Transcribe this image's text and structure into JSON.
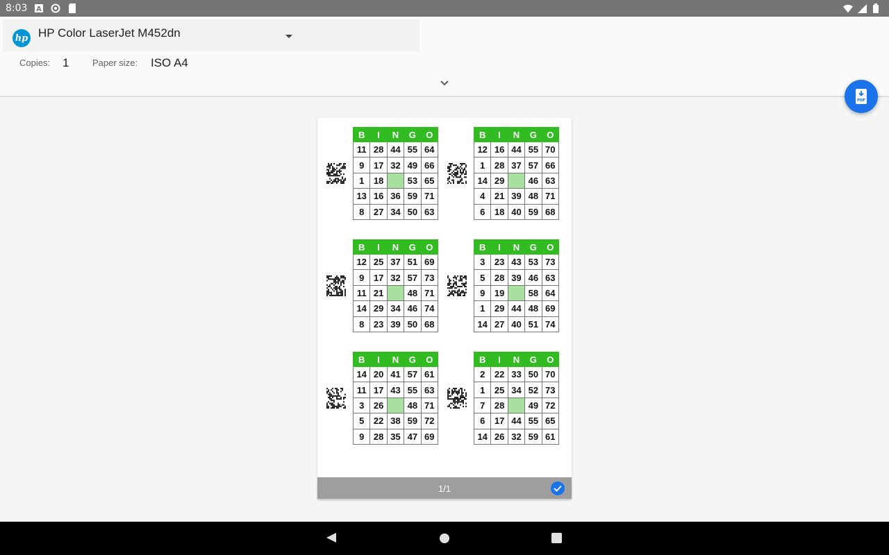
{
  "status_bar": {
    "time": "8:03",
    "left_icons": [
      "a-icon",
      "sync-icon",
      "sd-card-icon"
    ],
    "right_icons": [
      "wifi-icon",
      "signal-icon",
      "battery-icon"
    ]
  },
  "header": {
    "printer_name": "HP Color LaserJet M452dn",
    "printer_logo": "hp",
    "copies_label": "Copies:",
    "copies_value": "1",
    "paper_size_label": "Paper size:",
    "paper_size_value": "ISO A4"
  },
  "fab": {
    "label": "PDF"
  },
  "preview": {
    "page_indicator": "1/1",
    "header_letters": [
      "B",
      "I",
      "N",
      "G",
      "O"
    ],
    "cards": [
      [
        [
          "11",
          "28",
          "44",
          "55",
          "64"
        ],
        [
          "9",
          "17",
          "32",
          "49",
          "66"
        ],
        [
          "1",
          "18",
          "",
          "53",
          "65"
        ],
        [
          "13",
          "16",
          "36",
          "59",
          "71"
        ],
        [
          "8",
          "27",
          "34",
          "50",
          "63"
        ]
      ],
      [
        [
          "12",
          "16",
          "44",
          "55",
          "70"
        ],
        [
          "1",
          "28",
          "37",
          "57",
          "66"
        ],
        [
          "14",
          "29",
          "",
          "46",
          "63"
        ],
        [
          "4",
          "21",
          "39",
          "48",
          "71"
        ],
        [
          "6",
          "18",
          "40",
          "59",
          "68"
        ]
      ],
      [
        [
          "12",
          "25",
          "37",
          "51",
          "69"
        ],
        [
          "9",
          "17",
          "32",
          "57",
          "73"
        ],
        [
          "11",
          "21",
          "",
          "48",
          "71"
        ],
        [
          "14",
          "29",
          "34",
          "46",
          "74"
        ],
        [
          "8",
          "23",
          "39",
          "50",
          "68"
        ]
      ],
      [
        [
          "3",
          "23",
          "43",
          "53",
          "73"
        ],
        [
          "5",
          "28",
          "39",
          "46",
          "63"
        ],
        [
          "9",
          "19",
          "",
          "58",
          "64"
        ],
        [
          "1",
          "29",
          "44",
          "48",
          "69"
        ],
        [
          "14",
          "27",
          "40",
          "51",
          "74"
        ]
      ],
      [
        [
          "14",
          "20",
          "41",
          "57",
          "61"
        ],
        [
          "11",
          "17",
          "43",
          "55",
          "63"
        ],
        [
          "3",
          "26",
          "",
          "48",
          "71"
        ],
        [
          "5",
          "22",
          "38",
          "59",
          "72"
        ],
        [
          "9",
          "28",
          "35",
          "47",
          "69"
        ]
      ],
      [
        [
          "2",
          "22",
          "33",
          "50",
          "70"
        ],
        [
          "1",
          "25",
          "34",
          "52",
          "73"
        ],
        [
          "7",
          "28",
          "",
          "49",
          "72"
        ],
        [
          "6",
          "17",
          "44",
          "55",
          "65"
        ],
        [
          "14",
          "26",
          "32",
          "59",
          "61"
        ]
      ]
    ]
  },
  "colors": {
    "accent": "#1a73e8",
    "bingo_header": "#33bb22",
    "free_cell": "#a8e0a0",
    "hp_blue": "#0096d6"
  }
}
